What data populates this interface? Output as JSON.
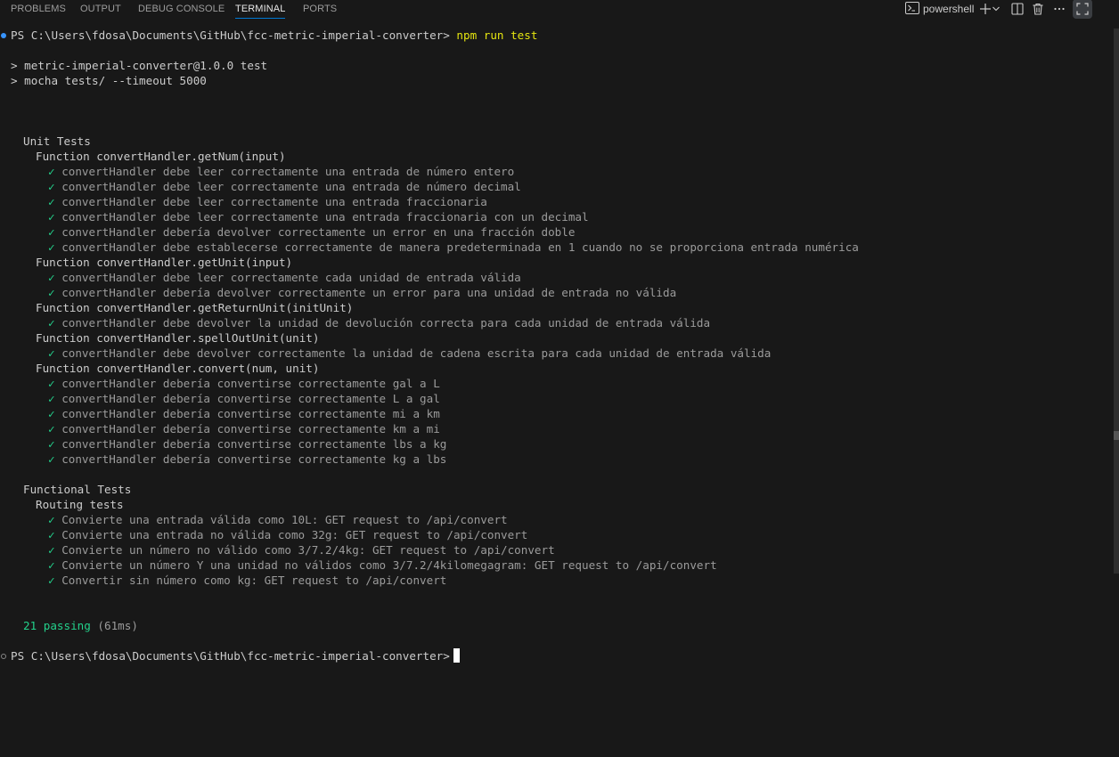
{
  "panel": {
    "tabs": [
      {
        "label": "PROBLEMS"
      },
      {
        "label": "OUTPUT"
      },
      {
        "label": "DEBUG CONSOLE"
      },
      {
        "label": "TERMINAL",
        "active": true
      },
      {
        "label": "PORTS"
      }
    ],
    "terminal_name": "powershell",
    "icons": [
      "terminal-icon",
      "plus-icon",
      "chevron-down-icon",
      "split-icon",
      "trash-icon",
      "more-icon",
      "maximize-icon"
    ]
  },
  "terminal": {
    "prompt1": {
      "path": "PS C:\\Users\\fdosa\\Documents\\GitHub\\fcc-metric-imperial-converter> ",
      "command": "npm run test"
    },
    "script_lines": [
      "> metric-imperial-converter@1.0.0 test",
      "> mocha tests/ --timeout 5000"
    ],
    "suites": {
      "unit_title": "Unit Tests",
      "unit_groups": [
        {
          "title": "Function convertHandler.getNum(input)",
          "tests": [
            "convertHandler debe leer correctamente una entrada de número entero",
            "convertHandler debe leer correctamente una entrada de número decimal",
            "convertHandler debe leer correctamente una entrada fraccionaria",
            "convertHandler debe leer correctamente una entrada fraccionaria con un decimal",
            "convertHandler debería devolver correctamente un error en una fracción doble",
            "convertHandler debe establecerse correctamente de manera predeterminada en 1 cuando no se proporciona entrada numérica"
          ]
        },
        {
          "title": "Function convertHandler.getUnit(input)",
          "tests": [
            "convertHandler debe leer correctamente cada unidad de entrada válida",
            "convertHandler debería devolver correctamente un error para una unidad de entrada no válida"
          ]
        },
        {
          "title": "Function convertHandler.getReturnUnit(initUnit)",
          "tests": [
            "convertHandler debe devolver la unidad de devolución correcta para cada unidad de entrada válida"
          ]
        },
        {
          "title": "Function convertHandler.spellOutUnit(unit)",
          "tests": [
            "convertHandler debe devolver correctamente la unidad de cadena escrita para cada unidad de entrada válida"
          ]
        },
        {
          "title": "Function convertHandler.convert(num, unit)",
          "tests": [
            "convertHandler debería convertirse correctamente gal a L",
            "convertHandler debería convertirse correctamente L a gal",
            "convertHandler debería convertirse correctamente mi a km",
            "convertHandler debería convertirse correctamente km a mi",
            "convertHandler debería convertirse correctamente lbs a kg",
            "convertHandler debería convertirse correctamente kg a lbs"
          ]
        }
      ],
      "functional_title": "Functional Tests",
      "functional_groups": [
        {
          "title": "Routing tests",
          "tests": [
            "Convierte una entrada válida como 10L: GET request to /api/convert",
            "Convierte una entrada no válida como 32g: GET request to /api/convert",
            "Convierte un número no válido como 3/7.2/4kg: GET request to /api/convert",
            "Convierte un número Y una unidad no válidos como 3/7.2/4kilomegagram: GET request to /api/convert",
            "Convertir sin número como kg: GET request to /api/convert"
          ]
        }
      ]
    },
    "check_glyph": "✓",
    "summary_passing": "21 passing",
    "summary_time": " (61ms)",
    "prompt2": {
      "path": "PS C:\\Users\\fdosa\\Documents\\GitHub\\fcc-metric-imperial-converter>"
    }
  },
  "colors": {
    "background": "#181818",
    "text": "#cccccc",
    "muted": "#9b9b9b",
    "check": "#23d18b",
    "command": "#e5e510",
    "active_tab_border": "#0078d4",
    "prompt_dot_active": "#3794ff",
    "prompt_dot_idle": "#858585"
  }
}
